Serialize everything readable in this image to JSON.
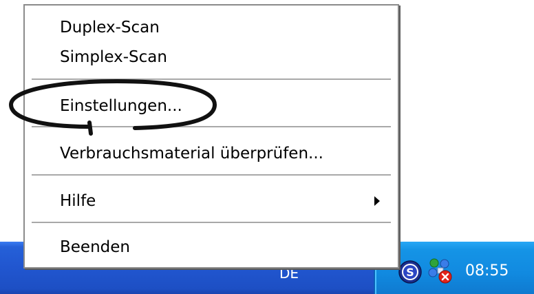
{
  "menu": {
    "items": [
      {
        "label": "Duplex-Scan"
      },
      {
        "label": "Simplex-Scan"
      },
      {
        "label": "Einstellungen..."
      },
      {
        "label": "Verbrauchsmaterial überprüfen..."
      },
      {
        "label": "Hilfe",
        "has_submenu": true
      },
      {
        "label": "Beenden"
      }
    ],
    "highlighted_item": "Einstellungen..."
  },
  "taskbar": {
    "language_indicator": "DE",
    "tray": {
      "icons": [
        "scanner-s-icon",
        "network-connection-error-icon"
      ],
      "clock": "08:55"
    }
  },
  "colors": {
    "taskbar_blue": "#2156cf",
    "tray_blue": "#118ae0",
    "annotation": "#111111"
  }
}
